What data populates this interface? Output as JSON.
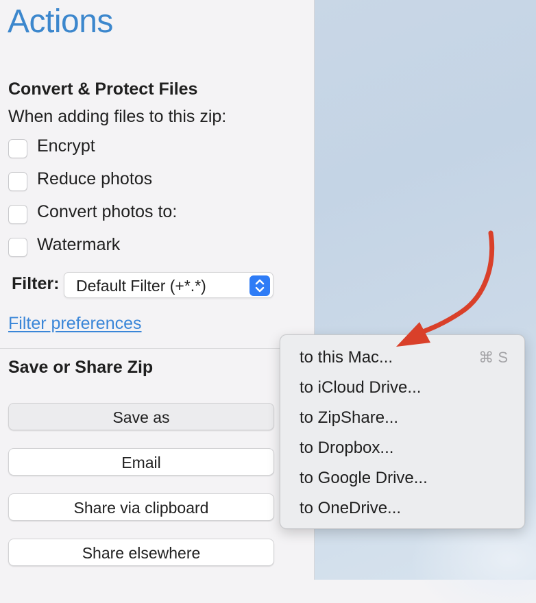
{
  "panel": {
    "title": "Actions",
    "convert": {
      "heading": "Convert & Protect Files",
      "subtitle": "When adding files to this zip:",
      "options": [
        {
          "label": "Encrypt",
          "checked": false
        },
        {
          "label": "Reduce photos",
          "checked": false
        },
        {
          "label": "Convert photos to:",
          "checked": false
        },
        {
          "label": "Watermark",
          "checked": false
        }
      ],
      "filter_label": "Filter:",
      "filter_value": "Default Filter (+*.*)",
      "filter_link": "Filter preferences"
    },
    "share": {
      "heading": "Save or Share Zip",
      "buttons": [
        "Save as",
        "Email",
        "Share via clipboard",
        "Share elsewhere"
      ]
    }
  },
  "save_menu": {
    "items": [
      {
        "label": "to this Mac...",
        "shortcut": "⌘ S"
      },
      {
        "label": "to iCloud Drive..."
      },
      {
        "label": "to ZipShare..."
      },
      {
        "label": "to Dropbox..."
      },
      {
        "label": "to Google Drive..."
      },
      {
        "label": "to OneDrive..."
      }
    ]
  },
  "colors": {
    "title": "#3c87cd",
    "link": "#3a86d8",
    "stepper": "#2e7cf6",
    "annotation_arrow": "#d9402a"
  },
  "icons": {
    "select_stepper": "updown-chevron-icon",
    "annotation": "curved-arrow-icon"
  }
}
